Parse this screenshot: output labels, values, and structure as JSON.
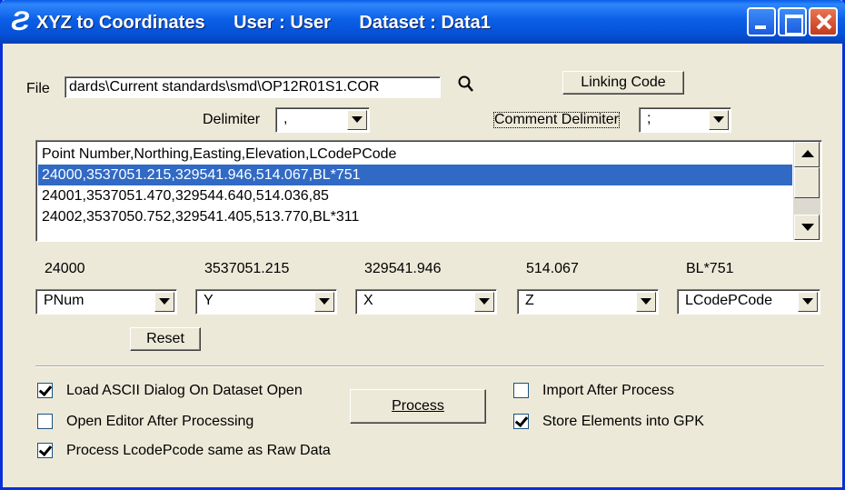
{
  "window": {
    "app_title": "XYZ to Coordinates",
    "user": "User : User",
    "dataset": "Dataset : Data1",
    "icon_glyph": "Ƨ"
  },
  "file": {
    "label": "File",
    "path": "dards\\Current standards\\smd\\OP12R01S1.COR",
    "linking_code_label": "Linking Code"
  },
  "delimiter": {
    "label": "Delimiter",
    "value": ","
  },
  "comment_delimiter": {
    "label": "Comment Delimiter",
    "value": ";"
  },
  "list": {
    "rows": [
      "Point Number,Northing,Easting,Elevation,LCodePCode",
      "24000,3537051.215,329541.946,514.067,BL*751",
      "24001,3537051.470,329544.640,514.036,85",
      "24002,3537050.752,329541.405,513.770,BL*311"
    ],
    "selected_index": 1
  },
  "preview": {
    "values": [
      "24000",
      "3537051.215",
      "329541.946",
      "514.067",
      "BL*751"
    ]
  },
  "columns": {
    "selects": [
      "PNum",
      "Y",
      "X",
      "Z",
      "LCodePCode"
    ]
  },
  "reset_label": "Reset",
  "options": {
    "load_ascii": {
      "label": "Load ASCII Dialog On Dataset Open",
      "checked": true
    },
    "open_editor": {
      "label": "Open Editor After Processing",
      "checked": false
    },
    "process_lcode": {
      "label": "Process LcodePcode same as Raw Data",
      "checked": true
    },
    "import_after": {
      "label": "Import After Process",
      "checked": false
    },
    "store_elements": {
      "label": "Store Elements into GPK",
      "checked": true
    }
  },
  "process_label": "Process",
  "icons": {
    "search": "search-icon",
    "app": "app-icon"
  }
}
